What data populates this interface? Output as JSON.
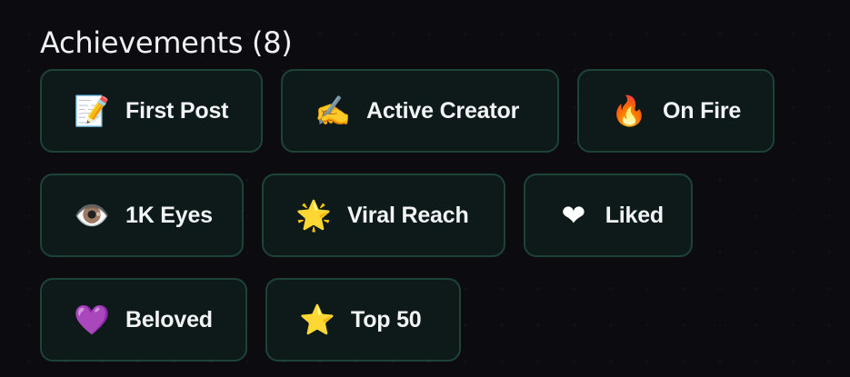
{
  "achievements": {
    "title": "Achievements (8)",
    "badges": [
      {
        "icon": "memo-icon",
        "emoji": "📝",
        "label": "First Post",
        "color": "#f5c542"
      },
      {
        "icon": "writing-hand-icon",
        "emoji": "✍️",
        "label": "Active Creator",
        "color": "#f3b34a"
      },
      {
        "icon": "fire-icon",
        "emoji": "🔥",
        "label": "On Fire",
        "color": "#ff6a1f"
      },
      {
        "icon": "eye-icon",
        "emoji": "👁️",
        "label": "1K Eyes",
        "color": "#b9b9b9"
      },
      {
        "icon": "glowing-star-icon",
        "emoji": "🌟",
        "label": "Viral Reach",
        "color": "#ffcc33"
      },
      {
        "icon": "heart-icon",
        "emoji": "❤",
        "label": "Liked",
        "color": "#ffffff"
      },
      {
        "icon": "purple-heart-icon",
        "emoji": "💜",
        "label": "Beloved",
        "color": "#9b4fd3"
      },
      {
        "icon": "star-icon",
        "emoji": "⭐",
        "label": "Top 50",
        "color": "#ffc21a"
      }
    ]
  },
  "colors": {
    "background": "#0c0c10",
    "badge_background": "#0e1a1a",
    "badge_border": "#1d4337",
    "text": "#f1f3f4"
  }
}
